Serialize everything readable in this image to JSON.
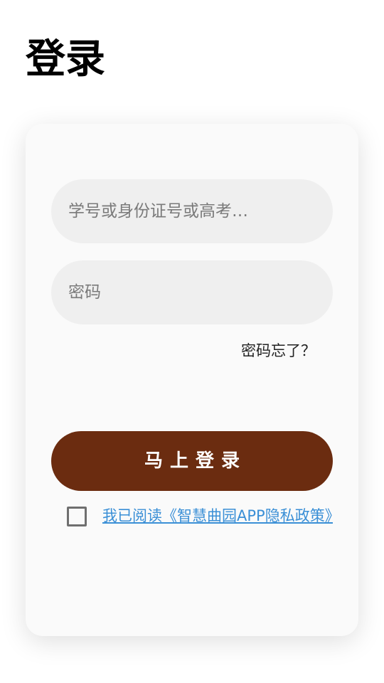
{
  "page": {
    "title": "登录"
  },
  "form": {
    "username_placeholder": "学号或身份证号或高考…",
    "username_value": "",
    "password_placeholder": "密码",
    "password_value": "",
    "forgot_label": "密码忘了？",
    "login_label": "马上登录",
    "agree_checked": false,
    "policy_text": "我已阅读《智慧曲园APP隐私政策》"
  },
  "colors": {
    "accent": "#6b2c10",
    "link": "#3a8fd6",
    "field_bg": "#efefef",
    "card_bg": "#fafafa"
  }
}
